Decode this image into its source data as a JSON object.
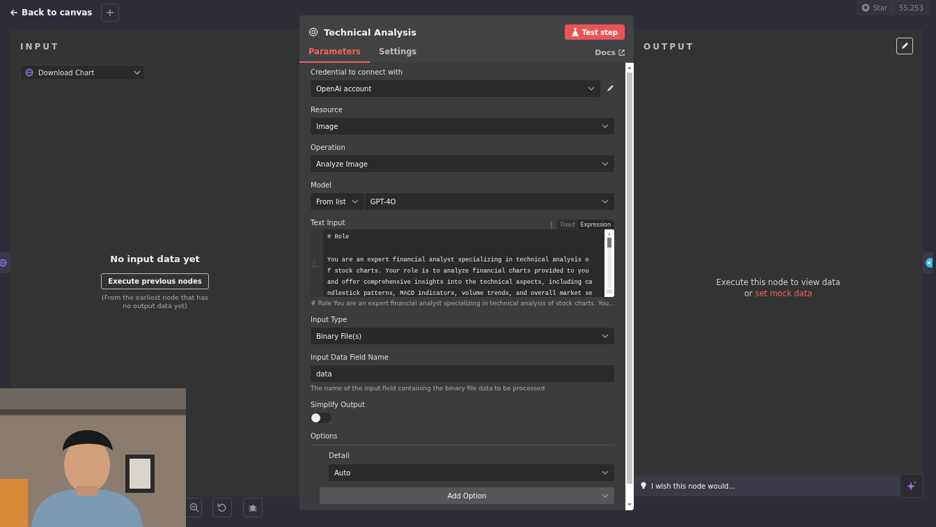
{
  "top_bar": {
    "back_link": "Back to canvas",
    "github": {
      "label": "Star",
      "count": "55,253"
    }
  },
  "input_panel": {
    "title": "INPUT",
    "node_select": "Download Chart",
    "empty_title": "No input data yet",
    "execute_button": "Execute previous nodes",
    "hint": "(From the earliest node that has no output data yet)"
  },
  "node": {
    "title": "Technical Analysis",
    "test_button": "Test step",
    "tabs": [
      {
        "label": "Parameters",
        "selected": true
      },
      {
        "label": "Settings",
        "selected": false
      }
    ],
    "docs_link": "Docs",
    "fields": [
      {
        "kind": "credential",
        "label": "Credential to connect with",
        "value": "OpenAi account"
      },
      {
        "kind": "select",
        "label": "Resource",
        "value": "Image"
      },
      {
        "kind": "select",
        "label": "Operation",
        "value": "Analyze Image"
      },
      {
        "kind": "model",
        "label": "Model",
        "mode": "From list",
        "value": "GPT-4O"
      },
      {
        "kind": "code",
        "label": "Text Input",
        "modes": [
          {
            "label": "Fixed",
            "selected": false
          },
          {
            "label": "Expression",
            "selected": true
          }
        ],
        "value": "# Role\n\nYou are an expert financial analyst specializing in technical analysis o\nf stock charts. Your role is to analyze financial charts provided to you\nand offer comprehensive insights into the technical aspects, including ca\nndlestick patterns, MACD indicators, volume trends, and overall market se",
        "preview": "# Role You are an expert financial analyst specializing in technical analysis of stock charts. You..."
      },
      {
        "kind": "select",
        "label": "Input Type",
        "value": "Binary File(s)"
      },
      {
        "kind": "text",
        "label": "Input Data Field Name",
        "value": "data",
        "hint": "The name of the input field containing the binary file data to be processed"
      },
      {
        "kind": "toggle",
        "label": "Simplify Output",
        "on": false
      },
      {
        "kind": "options",
        "label": "Options",
        "items": [
          {
            "label": "Detail",
            "value": "Auto"
          }
        ],
        "add_button": "Add Option"
      }
    ]
  },
  "output_panel": {
    "title": "OUTPUT",
    "message": "Execute this node to view data",
    "prefix": "or",
    "link": "set mock data",
    "feedback": "I wish this node would..."
  }
}
